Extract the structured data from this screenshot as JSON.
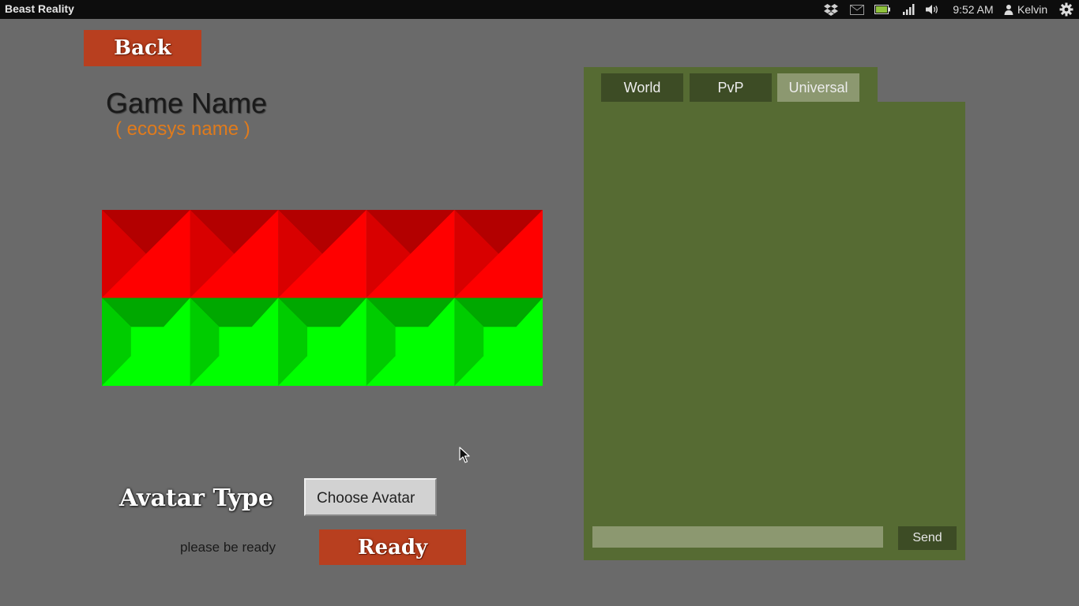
{
  "system_bar": {
    "app_title": "Beast Reality",
    "tray_icons": [
      "dropbox-icon",
      "mail-icon",
      "battery-icon",
      "network-signal-icon",
      "volume-icon"
    ],
    "clock": "9:52 AM",
    "user_name": "Kelvin",
    "settings_icon": "gear-icon"
  },
  "header": {
    "back_label": "Back",
    "game_name": "Game Name",
    "ecosys_name": "( ecosys name )"
  },
  "map": {
    "columns": 5,
    "rows": [
      {
        "team": "red",
        "colors": {
          "base": "#ff0000",
          "dark": "#b30000",
          "mid": "#d80000"
        }
      },
      {
        "team": "green",
        "colors": {
          "base": "#00ff00",
          "dark": "#00a800",
          "mid": "#00cc00"
        }
      }
    ]
  },
  "avatar": {
    "label": "Avatar Type",
    "select_value": "Choose Avatar"
  },
  "ready": {
    "note": "please be ready",
    "button_label": "Ready"
  },
  "chat": {
    "tabs": [
      {
        "label": "World",
        "active": false
      },
      {
        "label": "PvP",
        "active": false
      },
      {
        "label": "Universal",
        "active": true
      }
    ],
    "input_value": "",
    "send_label": "Send"
  },
  "colors": {
    "background": "#6a6a6a",
    "button_orange": "#b83f1f",
    "ecosys_orange": "#e07b1c",
    "chat_green": "#566b33",
    "tab_dark": "#3d4c25",
    "tab_active": "#8c9870"
  }
}
